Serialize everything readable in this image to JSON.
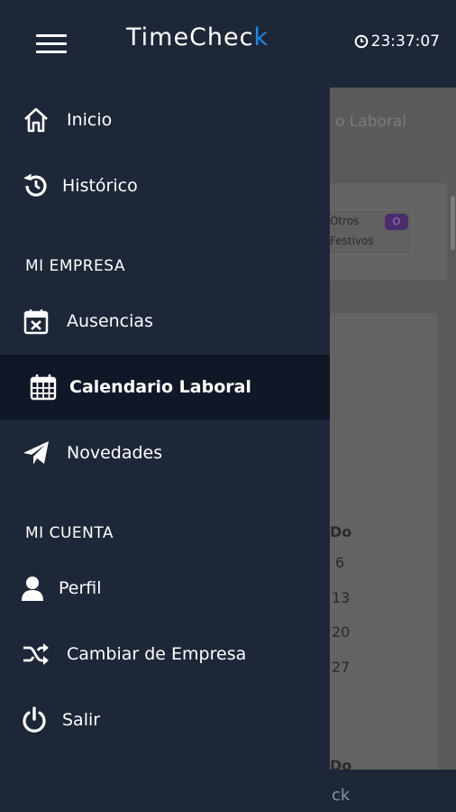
{
  "header": {
    "logo_main": "TimeChec",
    "logo_accent": "k",
    "clock": "23:37:07"
  },
  "drawer": {
    "items_top": [
      {
        "label": "Inicio",
        "icon": "home-icon"
      },
      {
        "label": "Histórico",
        "icon": "history-icon"
      }
    ],
    "section_company": "MI EMPRESA",
    "items_company": [
      {
        "label": "Ausencias",
        "icon": "calendar-x-icon"
      },
      {
        "label": "Calendario Laboral",
        "icon": "calendar-grid-icon",
        "active": true
      },
      {
        "label": "Novedades",
        "icon": "paper-plane-icon"
      }
    ],
    "section_account": "MI CUENTA",
    "items_account": [
      {
        "label": "Perfil",
        "icon": "user-icon"
      },
      {
        "label": "Cambiar de Empresa",
        "icon": "shuffle-icon"
      },
      {
        "label": "Salir",
        "icon": "power-icon"
      }
    ]
  },
  "background": {
    "title_fragment": "o Laboral",
    "legend_otros": "Otros",
    "legend_badge": "O",
    "legend_festivos": "Festivos",
    "day_header": "Do",
    "day_numbers": [
      "6",
      "13",
      "20",
      "27"
    ],
    "day_header_2": "Do",
    "footer_fragment": "ck"
  }
}
